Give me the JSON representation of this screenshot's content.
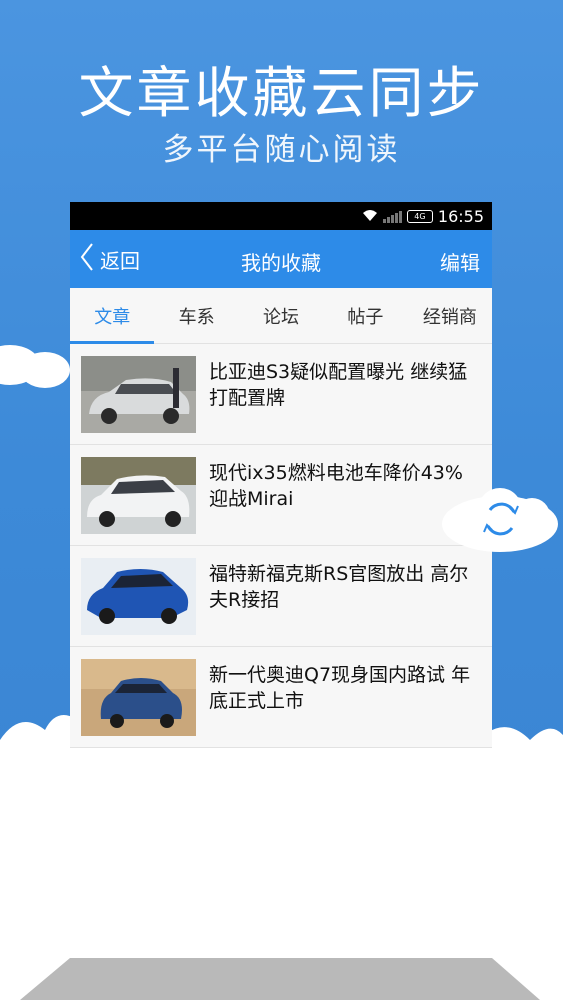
{
  "hero": {
    "title": "文章收藏云同步",
    "subtitle": "多平台随心阅读"
  },
  "status_bar": {
    "time": "16:55",
    "battery_label": "4G"
  },
  "nav": {
    "back_label": "返回",
    "title": "我的收藏",
    "edit_label": "编辑"
  },
  "tabs": [
    {
      "label": "文章",
      "active": true
    },
    {
      "label": "车系",
      "active": false
    },
    {
      "label": "论坛",
      "active": false
    },
    {
      "label": "帖子",
      "active": false
    },
    {
      "label": "经销商",
      "active": false
    }
  ],
  "articles": [
    {
      "title": "比亚迪S3疑似配置曝光 继续猛打配置牌",
      "thumb": "silver-suv-icon"
    },
    {
      "title": "现代ix35燃料电池车降价43% 迎战Mirai",
      "thumb": "white-suv-icon"
    },
    {
      "title": "福特新福克斯RS官图放出 高尔夫R接招",
      "thumb": "blue-hatchback-icon"
    },
    {
      "title": "新一代奥迪Q7现身国内路试 年底正式上市",
      "thumb": "blue-audi-suv-icon"
    }
  ],
  "colors": {
    "accent": "#2d8be8",
    "background": "#3b8ad9"
  }
}
